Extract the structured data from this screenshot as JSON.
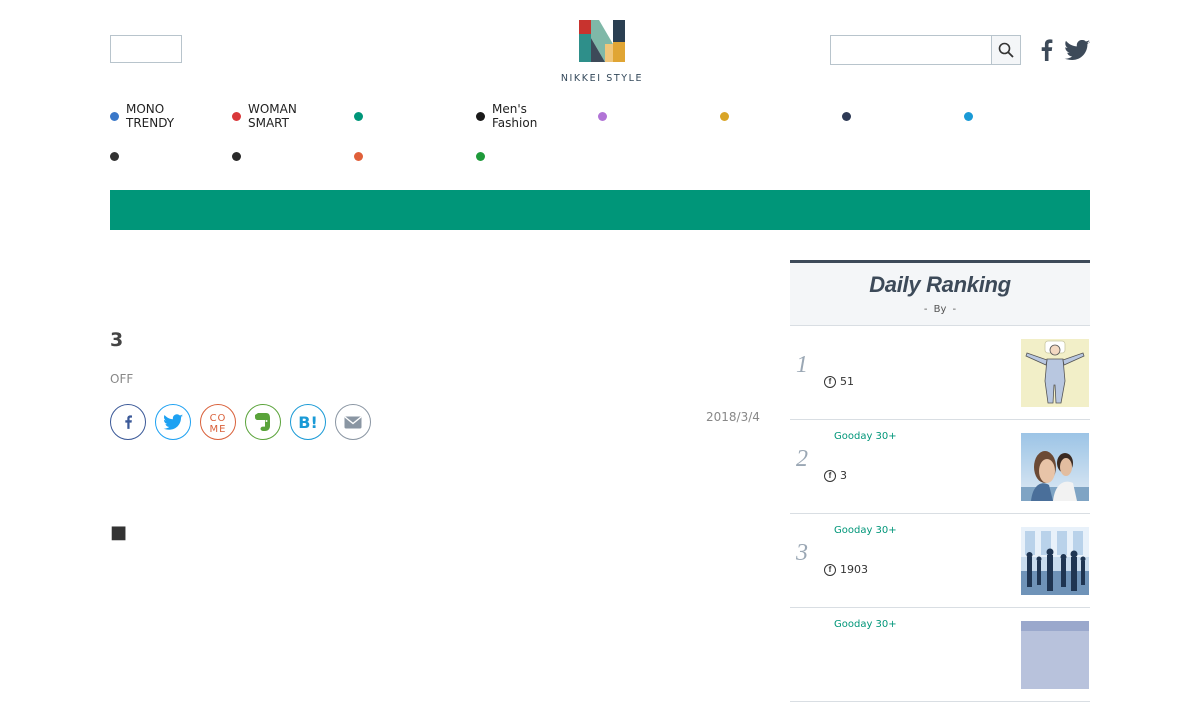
{
  "header": {
    "logo_text": "NIKKEI STYLE",
    "search": {
      "placeholder": ""
    },
    "social": [
      "facebook-icon",
      "twitter-icon"
    ]
  },
  "nav": {
    "rows": [
      [
        {
          "label": "MONO\nTRENDY",
          "color": "#3a78c9"
        },
        {
          "label": "WOMAN\nSMART",
          "color": "#d9383a"
        },
        {
          "label": "",
          "color": "#009679"
        },
        {
          "label": "Men's\nFashion",
          "color": "#1a1a1a"
        },
        {
          "label": "",
          "color": "#b174d6"
        },
        {
          "label": "",
          "color": "#d9a528"
        },
        {
          "label": "",
          "color": "#2e3a55"
        },
        {
          "label": "",
          "color": "#1a9ad6"
        }
      ],
      [
        {
          "label": "",
          "color": "#333333"
        },
        {
          "label": "",
          "color": "#2a2a2a"
        },
        {
          "label": "",
          "color": "#e0603a"
        },
        {
          "label": "",
          "color": "#1e9a3a"
        }
      ]
    ]
  },
  "article": {
    "title": "3",
    "category": "OFF",
    "date": "2018/3/4",
    "square": "■",
    "share": [
      {
        "name": "facebook-share-button",
        "icon": "facebook-icon",
        "color": "#3b5998"
      },
      {
        "name": "twitter-share-button",
        "icon": "twitter-icon",
        "color": "#1da1f2"
      },
      {
        "name": "come-share-button",
        "icon": "come-icon",
        "color": "#d9603a",
        "text": "CO\nME"
      },
      {
        "name": "evernote-share-button",
        "icon": "evernote-icon",
        "color": "#5aa33a"
      },
      {
        "name": "hatena-share-button",
        "icon": "hatena-bookmark-icon",
        "color": "#1a9ad6",
        "text": "B!"
      },
      {
        "name": "mail-share-button",
        "icon": "mail-icon",
        "color": "#8a96a3"
      }
    ]
  },
  "ranking": {
    "title": "Daily Ranking",
    "by": "- By -",
    "items": [
      {
        "rank": "1",
        "tag": "",
        "likes": "51",
        "thumb": "man-lying-icon"
      },
      {
        "rank": "2",
        "tag": "Gooday 30+",
        "likes": "3",
        "thumb": "couple-sky-icon"
      },
      {
        "rank": "3",
        "tag": "Gooday 30+",
        "likes": "1903",
        "thumb": "crowd-office-icon"
      },
      {
        "rank": "",
        "tag": "Gooday 30+",
        "likes": "",
        "thumb": "photo-icon"
      }
    ]
  }
}
